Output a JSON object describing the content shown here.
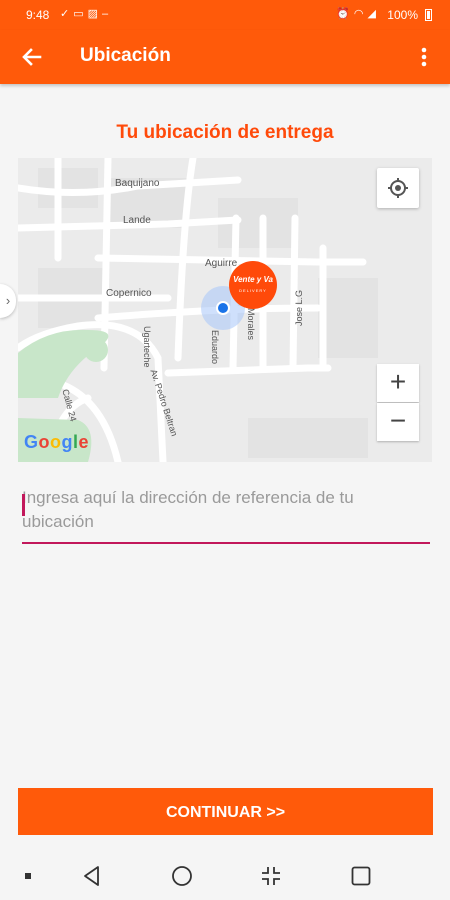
{
  "status_bar": {
    "time": "9:48",
    "battery": "100%",
    "left_icons": [
      "check-icon",
      "message-icon",
      "image-icon",
      "dash-icon"
    ],
    "right_icons": [
      "alarm-icon",
      "wifi-icon",
      "signal-icon"
    ]
  },
  "app_bar": {
    "title": "Ubicación",
    "back_icon": "back-arrow-icon",
    "menu_icon": "more-vert-icon"
  },
  "heading": "Tu ubicación de entrega",
  "map": {
    "street_labels": [
      "Baquijano",
      "Lande",
      "Aguirre",
      "Copernico",
      "Ugarteche",
      "Eduardo",
      "Morales",
      "Jose L.G",
      "Av. Pedro Beltran",
      "Calle 24"
    ],
    "zoom_in": "+",
    "zoom_out": "−",
    "side_tab": "›",
    "logo": [
      "G",
      "o",
      "o",
      "g",
      "l",
      "e"
    ],
    "marker": {
      "brand": "Vente y Va",
      "sub": "DELIVERY"
    }
  },
  "address_input": {
    "placeholder": "Ingresa aquí la dirección de referencia de tu ubicación",
    "value": ""
  },
  "continue_button": {
    "label": "CONTINUAR >>"
  },
  "colors": {
    "brand": "#ff5a0a",
    "accent": "#c2185b",
    "heading": "#ff4a0a"
  }
}
